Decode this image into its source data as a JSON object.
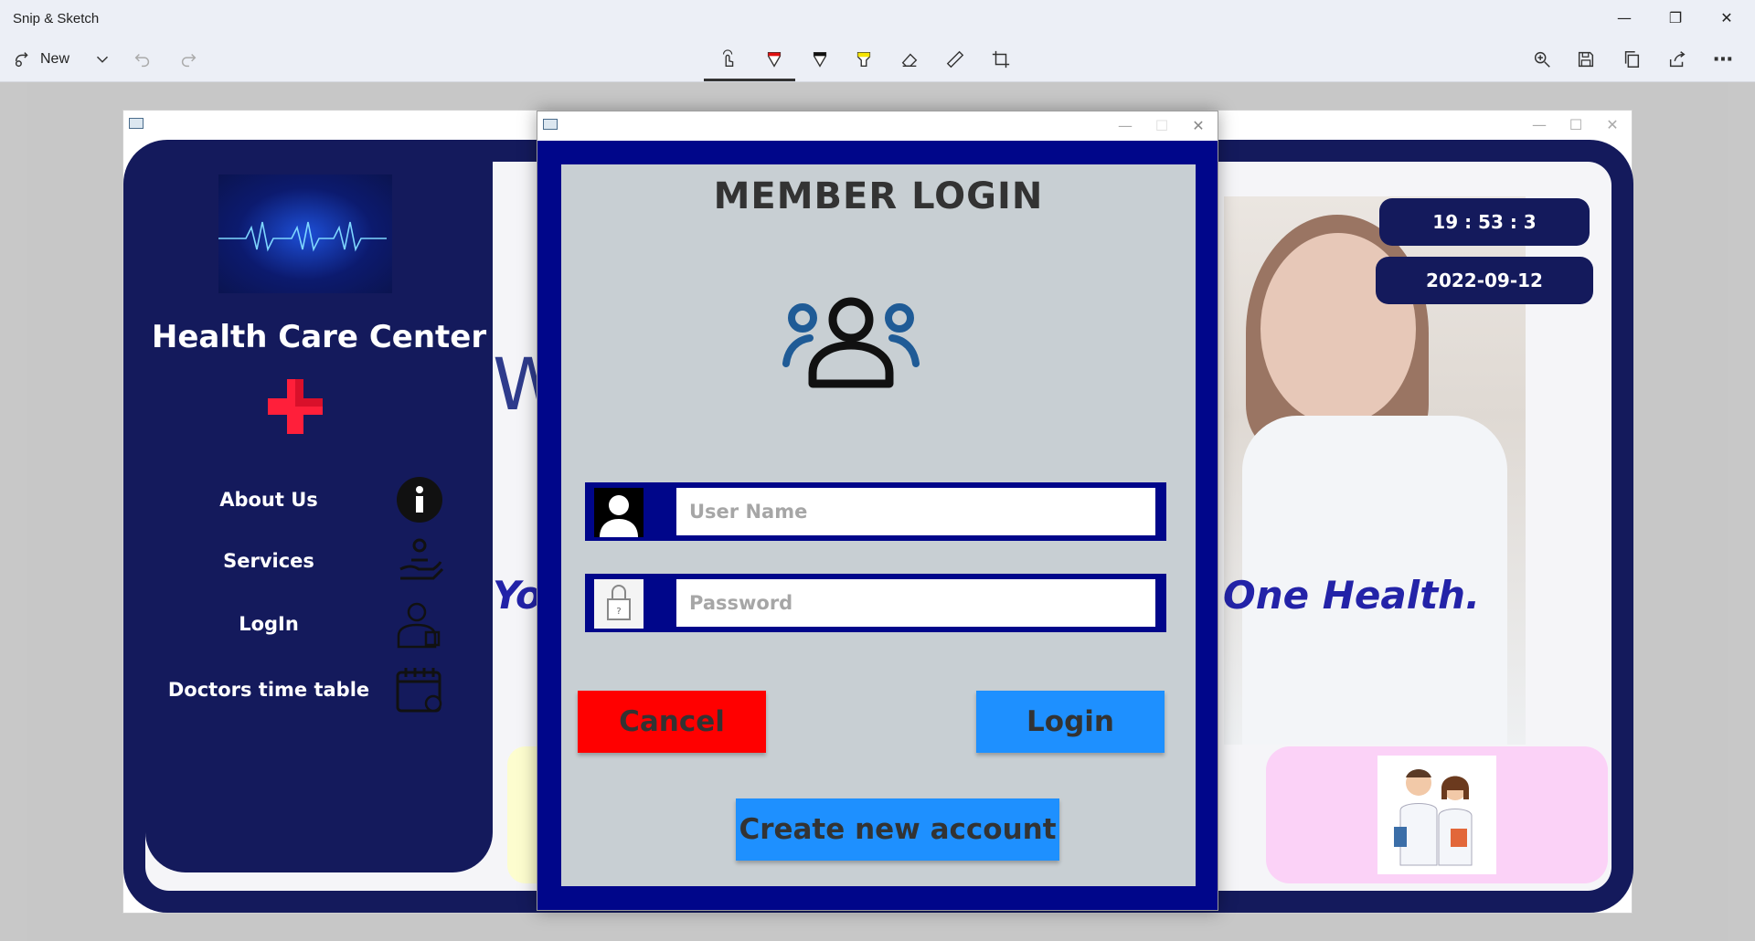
{
  "snip": {
    "title": "Snip & Sketch",
    "new_label": "New"
  },
  "app": {
    "brand": "Health Care Center",
    "welcome_fragment": "W",
    "tagline_left": "Yo",
    "tagline_right": "l One Health.",
    "time": "19 : 53 : 3",
    "date": "2022-09-12",
    "sidebar": [
      {
        "label": "About Us",
        "icon": "info-icon"
      },
      {
        "label": "Services",
        "icon": "hand-care-icon"
      },
      {
        "label": "LogIn",
        "icon": "doctor-icon"
      },
      {
        "label": "Doctors time table",
        "icon": "calendar-icon"
      }
    ],
    "colors": {
      "navy": "#141a5c",
      "accent_blue": "#2323a8",
      "cross_red": "#ff1f3a"
    }
  },
  "dialog": {
    "heading": "MEMBER LOGIN",
    "username_placeholder": "User Name",
    "password_placeholder": "Password",
    "cancel_label": "Cancel",
    "login_label": "Login",
    "create_label": "Create new account",
    "colors": {
      "frame": "#00068a",
      "panel": "#c8cfd3",
      "cancel": "#ff0000",
      "primary": "#1e90ff"
    }
  }
}
